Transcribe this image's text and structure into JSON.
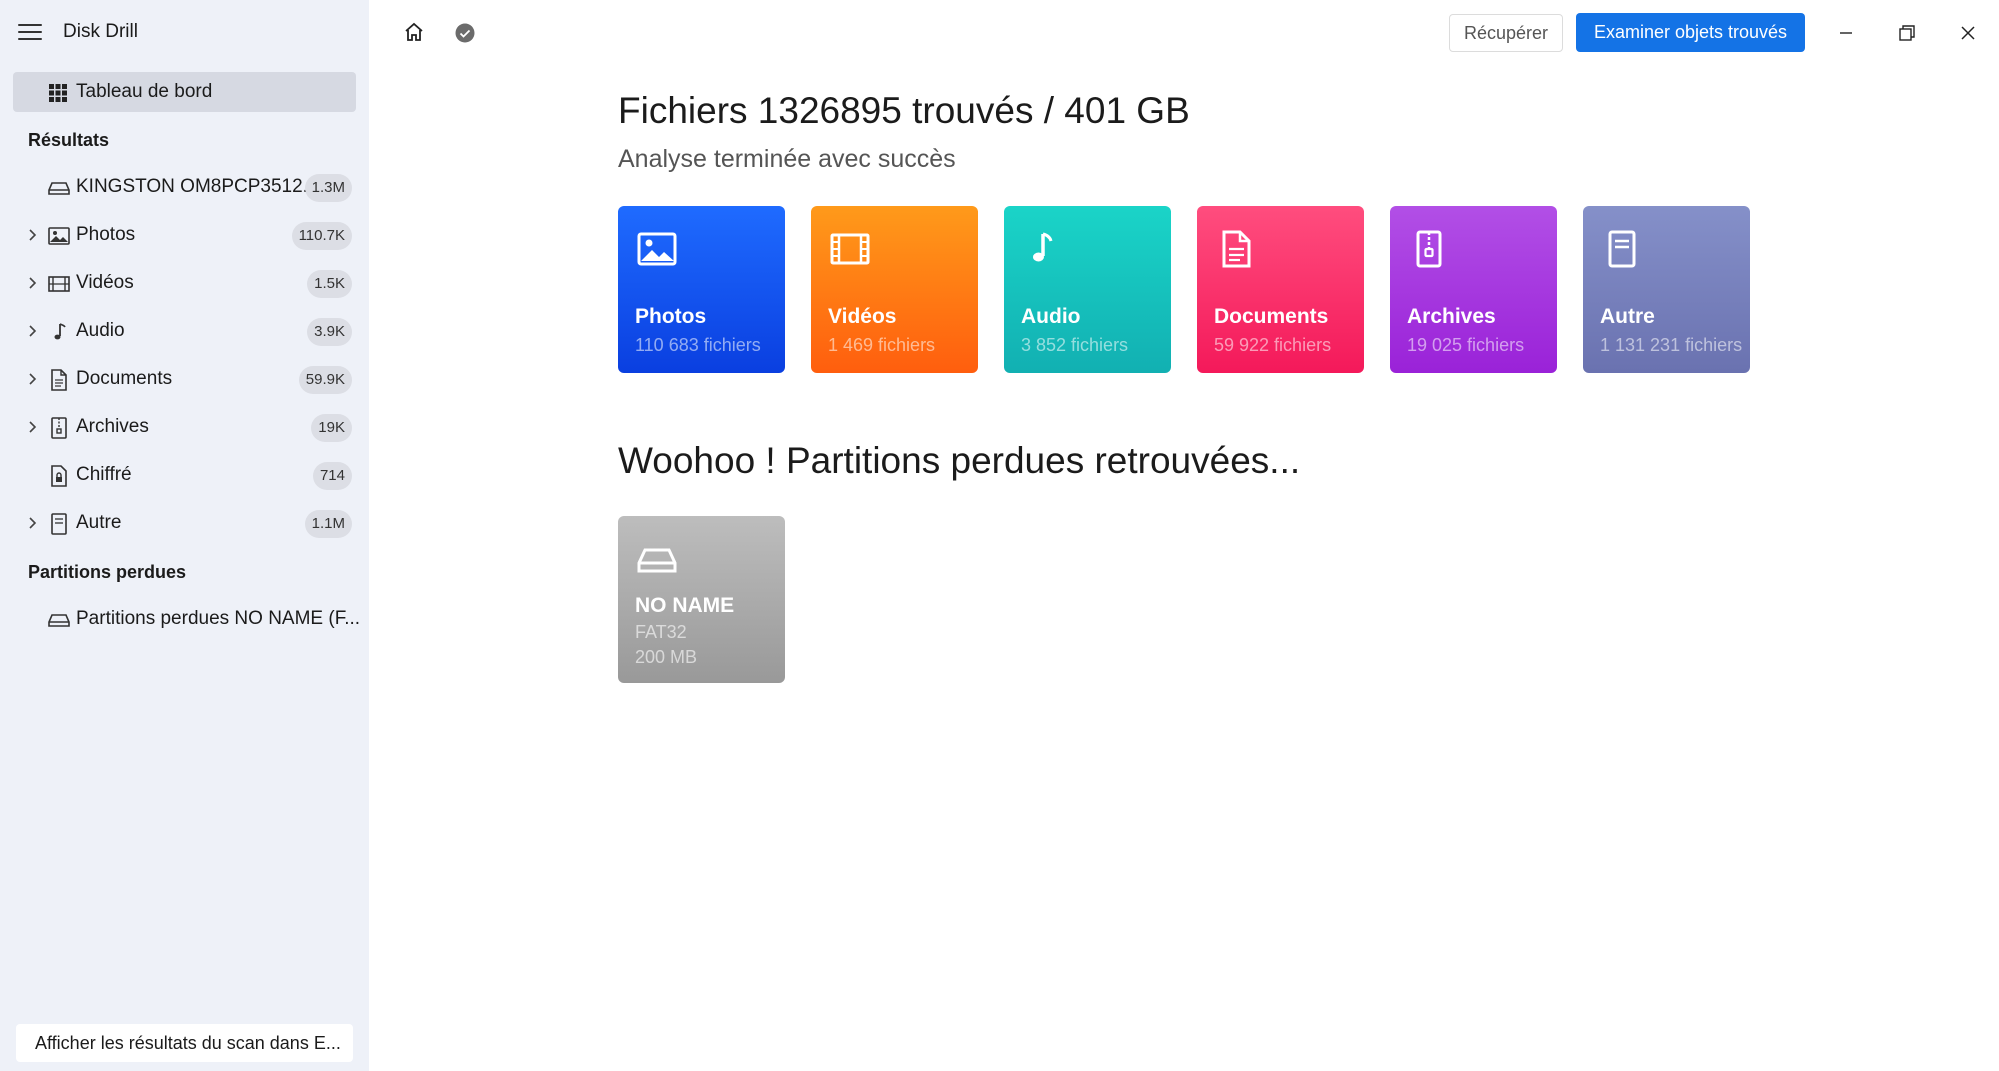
{
  "app": {
    "title": "Disk Drill"
  },
  "sidebar": {
    "dashboard_label": "Tableau de bord",
    "results_title": "Résultats",
    "items": [
      {
        "label": "KINGSTON OM8PCP3512...",
        "badge": "1.3M"
      },
      {
        "label": "Photos",
        "badge": "110.7K"
      },
      {
        "label": "Vidéos",
        "badge": "1.5K"
      },
      {
        "label": "Audio",
        "badge": "3.9K"
      },
      {
        "label": "Documents",
        "badge": "59.9K"
      },
      {
        "label": "Archives",
        "badge": "19K"
      },
      {
        "label": "Chiffré",
        "badge": "714"
      },
      {
        "label": "Autre",
        "badge": "1.1M"
      }
    ],
    "lost_title": "Partitions perdues",
    "lost_items": [
      {
        "label": "Partitions perdues NO NAME (F..."
      }
    ],
    "footer_button": "Afficher les résultats du scan dans E..."
  },
  "toolbar": {
    "recover_label": "Récupérer",
    "examine_label": "Examiner objets trouvés"
  },
  "main": {
    "title": "Fichiers 1326895 trouvés / 401 GB",
    "subtitle": "Analyse terminée avec succès",
    "categories": [
      {
        "name": "Photos",
        "count": "110 683 fichiers",
        "icon": "image-icon",
        "color_top": "#1f6bff",
        "color_bottom": "#0a3fe0"
      },
      {
        "name": "Vidéos",
        "count": "1 469 fichiers",
        "icon": "film-icon",
        "color_top": "#ff9a1a",
        "color_bottom": "#ff5e0e"
      },
      {
        "name": "Audio",
        "count": "3 852 fichiers",
        "icon": "music-note-icon",
        "color_top": "#1ad4c8",
        "color_bottom": "#12b0b2"
      },
      {
        "name": "Documents",
        "count": "59 922 fichiers",
        "icon": "document-icon",
        "color_top": "#ff4d7e",
        "color_bottom": "#f4195a"
      },
      {
        "name": "Archives",
        "count": "19 025 fichiers",
        "icon": "archive-icon",
        "color_top": "#b24fe6",
        "color_bottom": "#9a22d8"
      },
      {
        "name": "Autre",
        "count": "1 131 231 fichiers",
        "icon": "file-icon",
        "color_top": "#8590c9",
        "color_bottom": "#6a72b0"
      }
    ],
    "partitions_title": "Woohoo ! Partitions perdues retrouvées...",
    "partitions": [
      {
        "name": "NO NAME",
        "fs": "FAT32",
        "size": "200 MB",
        "icon": "drive-icon"
      }
    ]
  }
}
